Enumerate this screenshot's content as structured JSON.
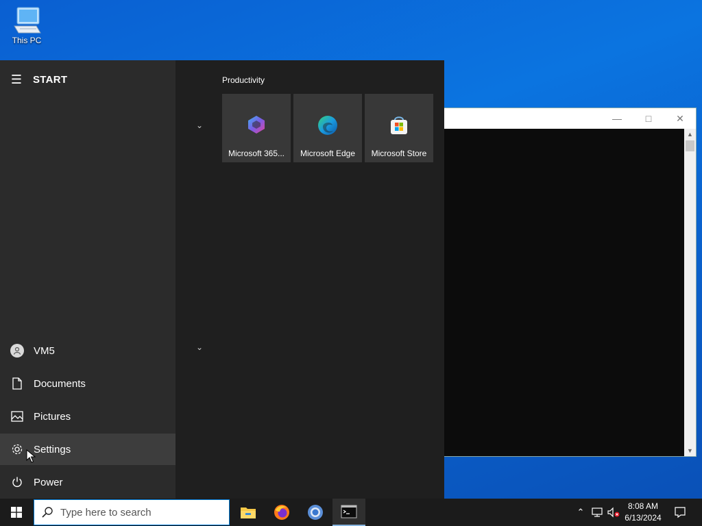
{
  "desktop": {
    "icons": [
      {
        "label": "This PC",
        "icon": "computer-icon"
      }
    ]
  },
  "start_menu": {
    "title": "START",
    "nav_items": [
      {
        "label": "VM5",
        "icon": "user-avatar-icon"
      },
      {
        "label": "Documents",
        "icon": "document-icon"
      },
      {
        "label": "Pictures",
        "icon": "pictures-icon"
      },
      {
        "label": "Settings",
        "icon": "gear-icon"
      },
      {
        "label": "Power",
        "icon": "power-icon"
      }
    ],
    "group": {
      "title": "Productivity",
      "tiles": [
        {
          "label": "Microsoft 365...",
          "icon": "microsoft-365-icon"
        },
        {
          "label": "Microsoft Edge",
          "icon": "edge-icon"
        },
        {
          "label": "Microsoft Store",
          "icon": "store-icon"
        }
      ]
    }
  },
  "taskbar": {
    "search_placeholder": "Type here to search",
    "apps": [
      "file-explorer-icon",
      "firefox-icon",
      "chrome-icon",
      "terminal-icon"
    ],
    "clock": {
      "time": "8:08 AM",
      "date": "6/13/2024"
    }
  },
  "colors": {
    "accent": "#0078d4",
    "start_left": "#2b2b2b",
    "start_right": "#1f1f1f",
    "tile": "#383838",
    "taskbar": "#1b1b1b"
  }
}
